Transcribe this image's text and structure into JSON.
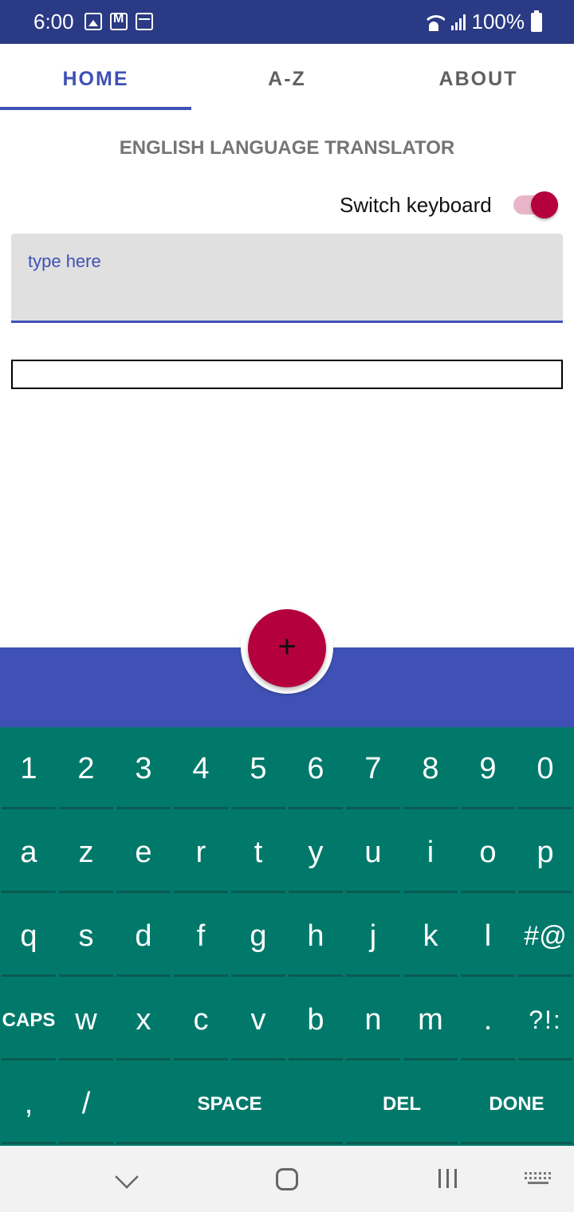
{
  "status_bar": {
    "time": "6:00",
    "battery": "100%",
    "icons_left": [
      "gallery-icon",
      "gmail-icon",
      "calendar-icon"
    ],
    "icons_right": [
      "wifi-icon",
      "signal-icon",
      "battery-icon"
    ]
  },
  "tabs": [
    {
      "label": "HOME",
      "active": true
    },
    {
      "label": "A-Z",
      "active": false
    },
    {
      "label": "ABOUT",
      "active": false
    }
  ],
  "main": {
    "title": "ENGLISH LANGUAGE TRANSLATOR",
    "switch_label": "Switch keyboard",
    "switch_on": true,
    "input_placeholder": "type here",
    "output_text": ""
  },
  "fab": {
    "icon": "+"
  },
  "keyboard": {
    "rows": [
      [
        "1",
        "2",
        "3",
        "4",
        "5",
        "6",
        "7",
        "8",
        "9",
        "0"
      ],
      [
        "a",
        "z",
        "e",
        "r",
        "t",
        "y",
        "u",
        "i",
        "o",
        "p"
      ],
      [
        "q",
        "s",
        "d",
        "f",
        "g",
        "h",
        "j",
        "k",
        "l",
        "#@"
      ],
      [
        "CAPS",
        "w",
        "x",
        "c",
        "v",
        "b",
        "n",
        "m",
        ".",
        "?!:"
      ],
      [
        ",",
        "/",
        "SPACE",
        "DEL",
        "DONE"
      ]
    ]
  },
  "colors": {
    "primary": "#3f51b5",
    "accent": "#b5003e",
    "keyboard": "#00796b",
    "status_bar": "#2b3a84"
  }
}
